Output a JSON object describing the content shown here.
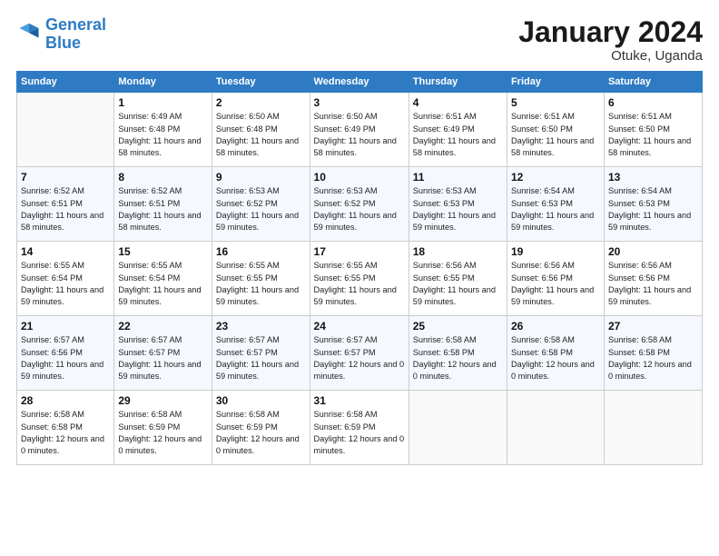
{
  "logo": {
    "line1": "General",
    "line2": "Blue"
  },
  "title": "January 2024",
  "subtitle": "Otuke, Uganda",
  "header_days": [
    "Sunday",
    "Monday",
    "Tuesday",
    "Wednesday",
    "Thursday",
    "Friday",
    "Saturday"
  ],
  "weeks": [
    [
      {
        "day": "",
        "empty": true
      },
      {
        "day": "1",
        "sunrise": "6:49 AM",
        "sunset": "6:48 PM",
        "daylight": "11 hours and 58 minutes."
      },
      {
        "day": "2",
        "sunrise": "6:50 AM",
        "sunset": "6:48 PM",
        "daylight": "11 hours and 58 minutes."
      },
      {
        "day": "3",
        "sunrise": "6:50 AM",
        "sunset": "6:49 PM",
        "daylight": "11 hours and 58 minutes."
      },
      {
        "day": "4",
        "sunrise": "6:51 AM",
        "sunset": "6:49 PM",
        "daylight": "11 hours and 58 minutes."
      },
      {
        "day": "5",
        "sunrise": "6:51 AM",
        "sunset": "6:50 PM",
        "daylight": "11 hours and 58 minutes."
      },
      {
        "day": "6",
        "sunrise": "6:51 AM",
        "sunset": "6:50 PM",
        "daylight": "11 hours and 58 minutes."
      }
    ],
    [
      {
        "day": "7",
        "sunrise": "6:52 AM",
        "sunset": "6:51 PM",
        "daylight": "11 hours and 58 minutes."
      },
      {
        "day": "8",
        "sunrise": "6:52 AM",
        "sunset": "6:51 PM",
        "daylight": "11 hours and 58 minutes."
      },
      {
        "day": "9",
        "sunrise": "6:53 AM",
        "sunset": "6:52 PM",
        "daylight": "11 hours and 59 minutes."
      },
      {
        "day": "10",
        "sunrise": "6:53 AM",
        "sunset": "6:52 PM",
        "daylight": "11 hours and 59 minutes."
      },
      {
        "day": "11",
        "sunrise": "6:53 AM",
        "sunset": "6:53 PM",
        "daylight": "11 hours and 59 minutes."
      },
      {
        "day": "12",
        "sunrise": "6:54 AM",
        "sunset": "6:53 PM",
        "daylight": "11 hours and 59 minutes."
      },
      {
        "day": "13",
        "sunrise": "6:54 AM",
        "sunset": "6:53 PM",
        "daylight": "11 hours and 59 minutes."
      }
    ],
    [
      {
        "day": "14",
        "sunrise": "6:55 AM",
        "sunset": "6:54 PM",
        "daylight": "11 hours and 59 minutes."
      },
      {
        "day": "15",
        "sunrise": "6:55 AM",
        "sunset": "6:54 PM",
        "daylight": "11 hours and 59 minutes."
      },
      {
        "day": "16",
        "sunrise": "6:55 AM",
        "sunset": "6:55 PM",
        "daylight": "11 hours and 59 minutes."
      },
      {
        "day": "17",
        "sunrise": "6:55 AM",
        "sunset": "6:55 PM",
        "daylight": "11 hours and 59 minutes."
      },
      {
        "day": "18",
        "sunrise": "6:56 AM",
        "sunset": "6:55 PM",
        "daylight": "11 hours and 59 minutes."
      },
      {
        "day": "19",
        "sunrise": "6:56 AM",
        "sunset": "6:56 PM",
        "daylight": "11 hours and 59 minutes."
      },
      {
        "day": "20",
        "sunrise": "6:56 AM",
        "sunset": "6:56 PM",
        "daylight": "11 hours and 59 minutes."
      }
    ],
    [
      {
        "day": "21",
        "sunrise": "6:57 AM",
        "sunset": "6:56 PM",
        "daylight": "11 hours and 59 minutes."
      },
      {
        "day": "22",
        "sunrise": "6:57 AM",
        "sunset": "6:57 PM",
        "daylight": "11 hours and 59 minutes."
      },
      {
        "day": "23",
        "sunrise": "6:57 AM",
        "sunset": "6:57 PM",
        "daylight": "11 hours and 59 minutes."
      },
      {
        "day": "24",
        "sunrise": "6:57 AM",
        "sunset": "6:57 PM",
        "daylight": "12 hours and 0 minutes."
      },
      {
        "day": "25",
        "sunrise": "6:58 AM",
        "sunset": "6:58 PM",
        "daylight": "12 hours and 0 minutes."
      },
      {
        "day": "26",
        "sunrise": "6:58 AM",
        "sunset": "6:58 PM",
        "daylight": "12 hours and 0 minutes."
      },
      {
        "day": "27",
        "sunrise": "6:58 AM",
        "sunset": "6:58 PM",
        "daylight": "12 hours and 0 minutes."
      }
    ],
    [
      {
        "day": "28",
        "sunrise": "6:58 AM",
        "sunset": "6:58 PM",
        "daylight": "12 hours and 0 minutes."
      },
      {
        "day": "29",
        "sunrise": "6:58 AM",
        "sunset": "6:59 PM",
        "daylight": "12 hours and 0 minutes."
      },
      {
        "day": "30",
        "sunrise": "6:58 AM",
        "sunset": "6:59 PM",
        "daylight": "12 hours and 0 minutes."
      },
      {
        "day": "31",
        "sunrise": "6:58 AM",
        "sunset": "6:59 PM",
        "daylight": "12 hours and 0 minutes."
      },
      {
        "day": "",
        "empty": true
      },
      {
        "day": "",
        "empty": true
      },
      {
        "day": "",
        "empty": true
      }
    ]
  ],
  "labels": {
    "sunrise_prefix": "Sunrise: ",
    "sunset_prefix": "Sunset: ",
    "daylight_prefix": "Daylight: "
  }
}
